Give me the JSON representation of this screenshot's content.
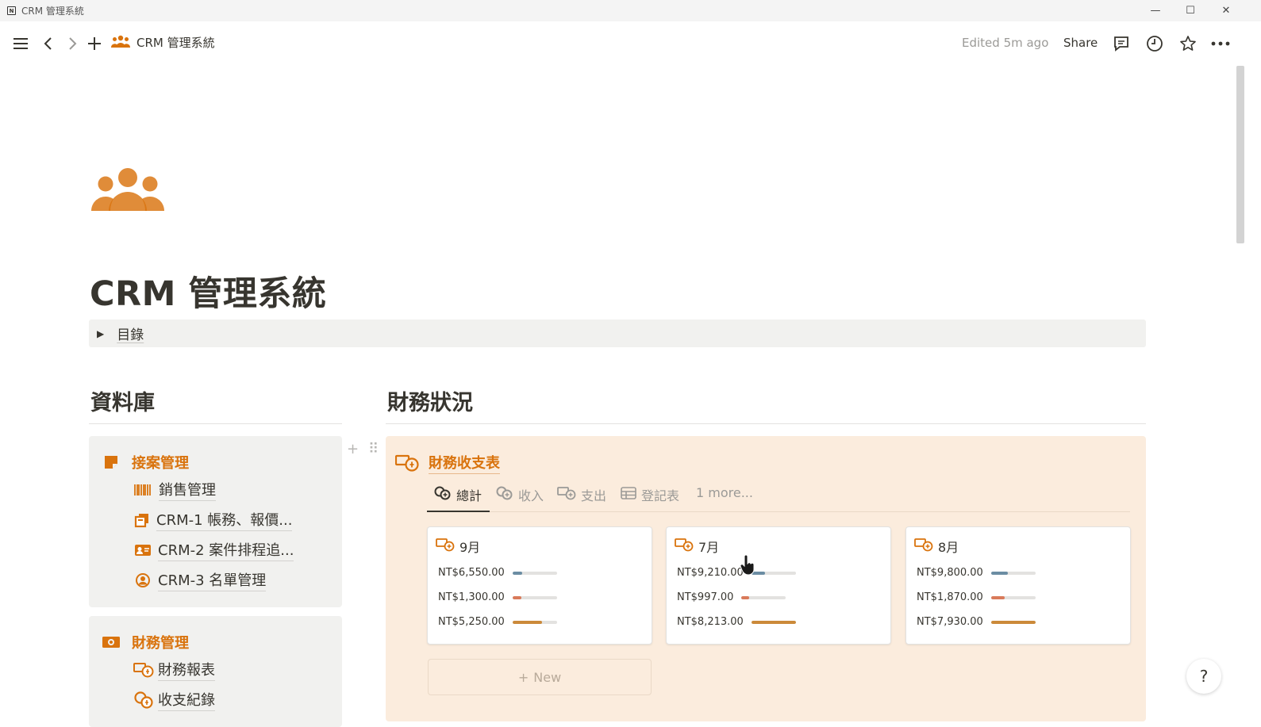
{
  "window": {
    "title": "CRM 管理系統",
    "minimize": "—",
    "maximize": "☐",
    "close": "✕"
  },
  "topbar": {
    "breadcrumb": "CRM 管理系統",
    "edited": "Edited 5m ago",
    "share": "Share"
  },
  "page": {
    "title": "CRM 管理系統",
    "toc_label": "目錄",
    "toc_arrow": "▶",
    "accent": "#d9730d"
  },
  "left": {
    "heading": "資料庫",
    "groups": [
      {
        "label": "接案管理",
        "icon": "note-icon",
        "items": [
          {
            "label": "銷售管理",
            "icon": "barcode-icon"
          },
          {
            "label": "CRM-1 帳務、報價...",
            "icon": "copy-icon"
          },
          {
            "label": "CRM-2 案件排程追...",
            "icon": "id-card-icon"
          },
          {
            "label": "CRM-3 名單管理",
            "icon": "user-circle-icon"
          }
        ]
      },
      {
        "label": "財務管理",
        "icon": "cash-icon",
        "items": [
          {
            "label": "財務報表",
            "icon": "money-exchange-icon"
          },
          {
            "label": "收支紀錄",
            "icon": "coins-icon"
          }
        ]
      }
    ]
  },
  "right": {
    "heading": "財務狀況",
    "db_title": "財務收支表",
    "tabs": [
      {
        "label": "總計",
        "active": true
      },
      {
        "label": "收入",
        "active": false
      },
      {
        "label": "支出",
        "active": false
      },
      {
        "label": "登記表",
        "active": false
      },
      {
        "label": "1 more...",
        "active": false
      }
    ],
    "cards": [
      {
        "title": "9月",
        "rows": [
          {
            "value": "NT$6,550.00",
            "fraction": 0.22,
            "color": "#6b8da3"
          },
          {
            "value": "NT$1,300.00",
            "fraction": 0.2,
            "color": "#d97a5a"
          },
          {
            "value": "NT$5,250.00",
            "fraction": 0.66,
            "color": "#cb8a3a"
          }
        ]
      },
      {
        "title": "7月",
        "rows": [
          {
            "value": "NT$9,210.00",
            "fraction": 0.31,
            "color": "#6b8da3"
          },
          {
            "value": "NT$997.00",
            "fraction": 0.17,
            "color": "#d97a5a"
          },
          {
            "value": "NT$8,213.00",
            "fraction": 1.0,
            "color": "#cb8a3a"
          }
        ]
      },
      {
        "title": "8月",
        "rows": [
          {
            "value": "NT$9,800.00",
            "fraction": 0.37,
            "color": "#6b8da3"
          },
          {
            "value": "NT$1,870.00",
            "fraction": 0.3,
            "color": "#d97a5a"
          },
          {
            "value": "NT$7,930.00",
            "fraction": 1.0,
            "color": "#cb8a3a"
          }
        ]
      }
    ],
    "new_label": "New"
  },
  "help": "?"
}
